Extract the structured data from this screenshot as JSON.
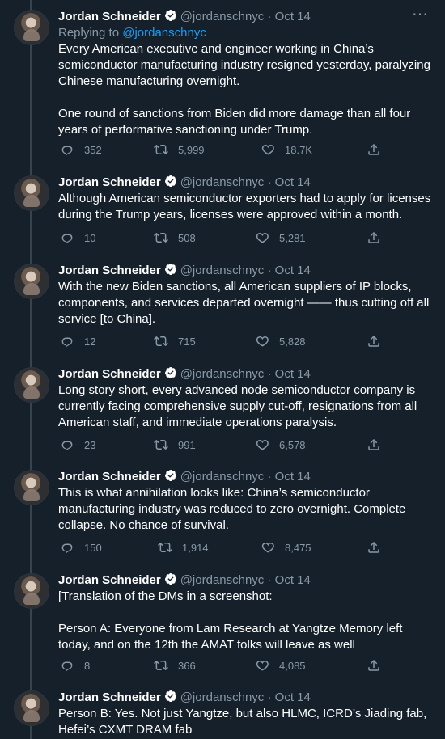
{
  "author": {
    "name": "Jordan Schneider",
    "handle": "@jordanschnyc",
    "date": "Oct 14"
  },
  "replying": {
    "prefix": "Replying to ",
    "handle": "@jordanschnyc"
  },
  "tweets": [
    {
      "text": "Every American executive and engineer working in China’s semiconductor manufacturing industry resigned yesterday, paralyzing Chinese manufacturing overnight.\n\nOne round of sanctions from Biden did more damage than all four years of performative sanctioning under Trump.",
      "replies": "352",
      "retweets": "5,999",
      "likes": "18.7K"
    },
    {
      "text": "Although American semiconductor exporters had to apply for licenses during the Trump years, licenses were approved within a month.",
      "replies": "10",
      "retweets": "508",
      "likes": "5,281"
    },
    {
      "text": "With the new Biden sanctions, all American suppliers of IP blocks, components, and services departed overnight —— thus cutting off all service [to China].",
      "replies": "12",
      "retweets": "715",
      "likes": "5,828"
    },
    {
      "text": "Long story short, every advanced node semiconductor company is currently facing comprehensive supply cut-off, resignations from all American staff, and immediate operations paralysis.",
      "replies": "23",
      "retweets": "991",
      "likes": "6,578"
    },
    {
      "text": "This is what annihilation looks like: China’s semiconductor manufacturing industry was reduced to zero overnight. Complete collapse. No chance of survival.",
      "replies": "150",
      "retweets": "1,914",
      "likes": "8,475"
    },
    {
      "text": "[Translation of the DMs in a screenshot:\n\nPerson A: Everyone from Lam Research at Yangtze Memory left today, and on the 12th the AMAT folks will leave as well",
      "replies": "8",
      "retweets": "366",
      "likes": "4,085"
    },
    {
      "text": "Person B: Yes. Not just Yangtze, but also HLMC, ICRD’s Jiading fab, Hefei’s CXMT DRAM fab",
      "replies": "",
      "retweets": "",
      "likes": ""
    }
  ],
  "icons": {
    "verified": "verified-badge-icon",
    "reply": "reply-icon",
    "retweet": "retweet-icon",
    "like": "heart-icon",
    "share": "share-icon",
    "more": "more-icon"
  },
  "colors": {
    "background": "#15202b",
    "text": "#ffffff",
    "muted": "#8899a6",
    "accent": "#1d9bf0",
    "thread_line": "#38444d"
  }
}
